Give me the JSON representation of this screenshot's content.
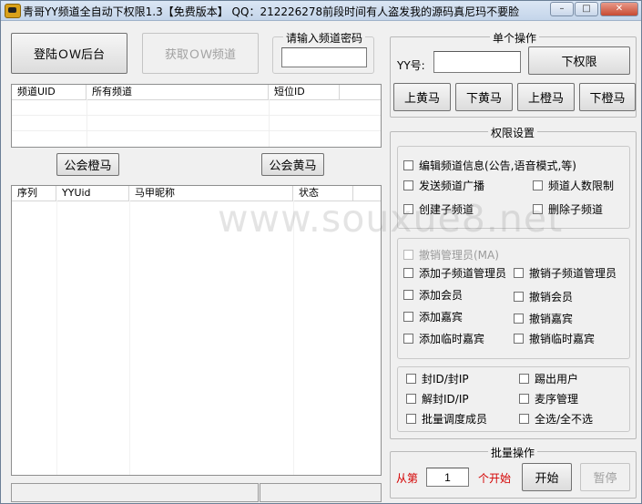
{
  "window": {
    "title": "青哥YY频道全自动下权限1.3【免费版本】 QQ：212226278前段时间有人盗发我的源码真尼玛不要脸"
  },
  "left": {
    "login_button": "登陆ＯＷ后台",
    "get_channel_button": "获取ＯＷ频道",
    "password_group_title": "请输入频道密码",
    "password_value": "",
    "channel_list": {
      "columns": [
        "频道UID",
        "所有频道",
        "短位ID"
      ],
      "rows": []
    },
    "guild_orange_button": "公会橙马",
    "guild_yellow_button": "公会黄马",
    "member_list": {
      "columns": [
        "序列",
        "YYUid",
        "马甲昵称",
        "状态"
      ],
      "rows": []
    }
  },
  "single_op": {
    "title": "单个操作",
    "yy_label": "YY号:",
    "yy_value": "",
    "remove_button": "下权限",
    "buttons": [
      "上黄马",
      "下黄马",
      "上橙马",
      "下橙马"
    ]
  },
  "permissions": {
    "title": "权限设置",
    "group1": [
      {
        "label": "编辑频道信息(公告,语音模式,等)",
        "checked": false
      },
      {
        "label": "发送频道广播",
        "checked": false
      },
      {
        "label": "频道人数限制",
        "checked": false
      },
      {
        "label": "创建子频道",
        "checked": false
      },
      {
        "label": "删除子频道",
        "checked": false
      }
    ],
    "group2": [
      {
        "label": "撤销管理员(MA)",
        "checked": false,
        "disabled": true
      },
      {
        "label": "添加子频道管理员",
        "checked": false
      },
      {
        "label": "撤销子频道管理员",
        "checked": false
      },
      {
        "label": "添加会员",
        "checked": false
      },
      {
        "label": "撤销会员",
        "checked": false
      },
      {
        "label": "添加嘉宾",
        "checked": false
      },
      {
        "label": "撤销嘉宾",
        "checked": false
      },
      {
        "label": "添加临时嘉宾",
        "checked": false
      },
      {
        "label": "撤销临时嘉宾",
        "checked": false
      }
    ],
    "group3": [
      {
        "label": "封ID/封IP",
        "checked": false
      },
      {
        "label": "踢出用户",
        "checked": false
      },
      {
        "label": "解封ID/IP",
        "checked": false
      },
      {
        "label": "麦序管理",
        "checked": false
      },
      {
        "label": "批量调度成员",
        "checked": false
      },
      {
        "label": "全选/全不选",
        "checked": false
      }
    ]
  },
  "batch": {
    "title": "批量操作",
    "from_label": "从第",
    "start_value": "1",
    "start_suffix": "个开始",
    "start_button": "开始",
    "pause_button": "暂停",
    "label_color": "#d40000"
  },
  "watermark": "www.souxue8.net"
}
